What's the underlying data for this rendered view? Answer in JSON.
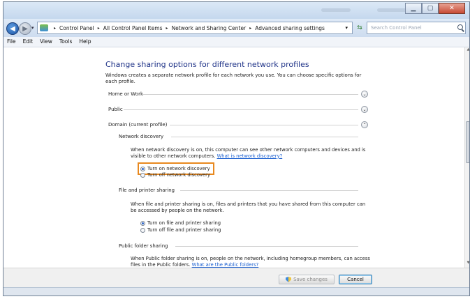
{
  "window": {
    "address": {
      "crumbs": [
        "Control Panel",
        "All Control Panel Items",
        "Network and Sharing Center",
        "Advanced sharing settings"
      ],
      "separator": "▸"
    },
    "search_placeholder": "Search Control Panel"
  },
  "menu": [
    "File",
    "Edit",
    "View",
    "Tools",
    "Help"
  ],
  "page": {
    "heading": "Change sharing options for different network profiles",
    "description": "Windows creates a separate network profile for each network you use. You can choose specific options for each profile.",
    "profiles": [
      {
        "name": "Home or Work",
        "expanded": false
      },
      {
        "name": "Public",
        "expanded": false
      },
      {
        "name": "Domain (current profile)",
        "expanded": true
      }
    ],
    "network_discovery": {
      "title": "Network discovery",
      "text": "When network discovery is on, this computer can see other network computers and devices and is visible to other network computers.",
      "link": "What is network discovery?",
      "options": [
        "Turn on network discovery",
        "Turn off network discovery"
      ],
      "selected": "Turn on network discovery"
    },
    "file_printer_sharing": {
      "title": "File and printer sharing",
      "text": "When file and printer sharing is on, files and printers that you have shared from this computer can be accessed by people on the network.",
      "options": [
        "Turn on file and printer sharing",
        "Turn off file and printer sharing"
      ],
      "selected": "Turn on file and printer sharing"
    },
    "public_folder_sharing": {
      "title": "Public folder sharing",
      "text": "When Public folder sharing is on, people on the network, including homegroup members, can access files in the Public folders.",
      "link": "What are the Public folders?"
    }
  },
  "buttons": {
    "save": "Save changes",
    "cancel": "Cancel"
  },
  "colors": {
    "heading": "#1e3287",
    "link": "#1a5fd0",
    "highlight": "#e8891f"
  }
}
